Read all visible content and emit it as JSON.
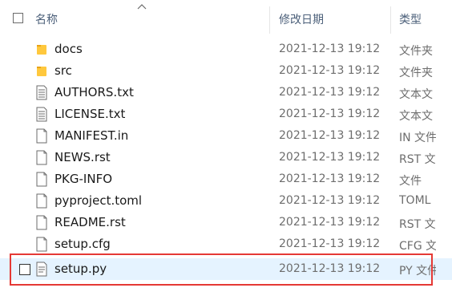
{
  "header": {
    "name_label": "名称",
    "date_label": "修改日期",
    "type_label": "类型"
  },
  "files": [
    {
      "name": "docs",
      "date": "2021-12-13 19:12",
      "type": "文件夹",
      "icon": "folder-icon"
    },
    {
      "name": "src",
      "date": "2021-12-13 19:12",
      "type": "文件夹",
      "icon": "folder-icon"
    },
    {
      "name": "AUTHORS.txt",
      "date": "2021-12-13 19:12",
      "type": "文本文",
      "icon": "text-file-icon"
    },
    {
      "name": "LICENSE.txt",
      "date": "2021-12-13 19:12",
      "type": "文本文",
      "icon": "text-file-icon"
    },
    {
      "name": "MANIFEST.in",
      "date": "2021-12-13 19:12",
      "type": "IN 文件",
      "icon": "file-icon"
    },
    {
      "name": "NEWS.rst",
      "date": "2021-12-13 19:12",
      "type": "RST 文",
      "icon": "file-icon"
    },
    {
      "name": "PKG-INFO",
      "date": "2021-12-13 19:12",
      "type": "文件",
      "icon": "file-icon"
    },
    {
      "name": "pyproject.toml",
      "date": "2021-12-13 19:12",
      "type": "TOML",
      "icon": "file-icon"
    },
    {
      "name": "README.rst",
      "date": "2021-12-13 19:12",
      "type": "RST 文",
      "icon": "file-icon"
    },
    {
      "name": "setup.cfg",
      "date": "2021-12-13 19:12",
      "type": "CFG 文",
      "icon": "file-icon"
    },
    {
      "name": "setup.py",
      "date": "2021-12-13 19:12",
      "type": "PY 文件",
      "icon": "python-file-icon"
    }
  ],
  "colors": {
    "selection_bg": "#e5f3ff",
    "highlight_border": "#e53935",
    "folder": "#ffc83d",
    "header_text": "#4c607a"
  }
}
